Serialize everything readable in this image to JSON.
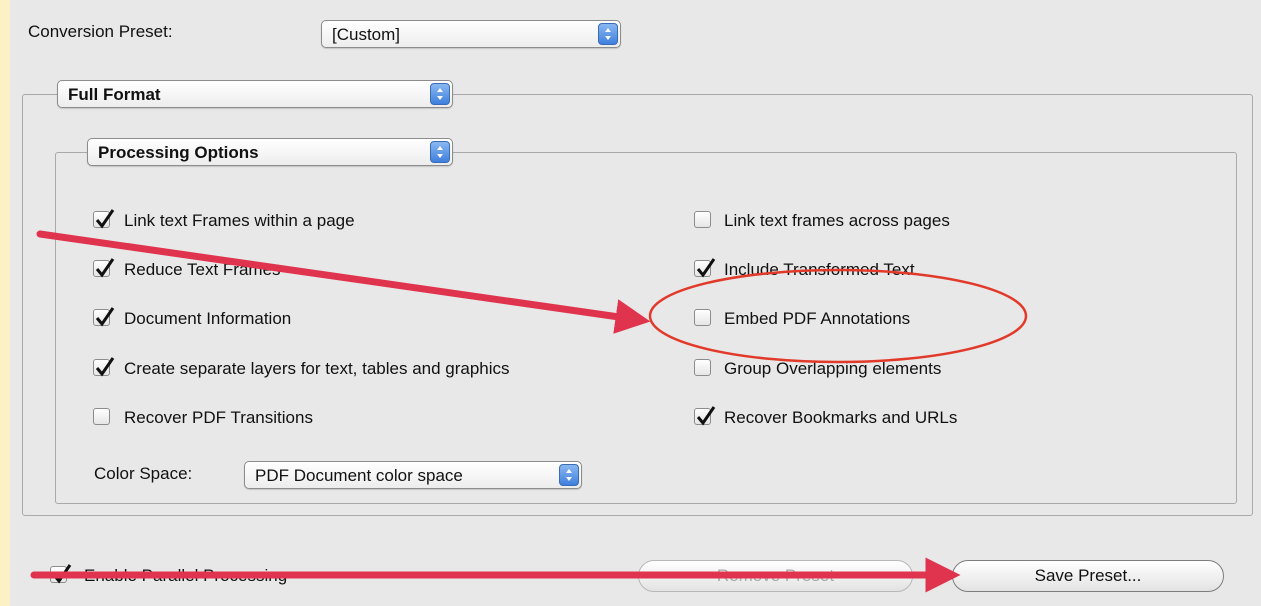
{
  "conversion_preset": {
    "label": "Conversion Preset:",
    "value": "[Custom]"
  },
  "format_popup": {
    "value": "Full Format"
  },
  "options_popup": {
    "value": "Processing Options"
  },
  "options": {
    "left": [
      {
        "label": "Link text Frames within a page",
        "checked": true
      },
      {
        "label": "Reduce Text Frames",
        "checked": true
      },
      {
        "label": "Document Information",
        "checked": true
      },
      {
        "label": "Create separate layers for text, tables and graphics",
        "checked": true
      },
      {
        "label": "Recover PDF Transitions",
        "checked": false
      }
    ],
    "right": [
      {
        "label": "Link text frames across pages",
        "checked": false
      },
      {
        "label": "Include Transformed Text",
        "checked": true
      },
      {
        "label": "Embed PDF Annotations",
        "checked": false
      },
      {
        "label": "Group Overlapping elements",
        "checked": false
      },
      {
        "label": "Recover Bookmarks and URLs",
        "checked": true
      }
    ]
  },
  "color_space": {
    "label": "Color Space:",
    "value": "PDF Document color space"
  },
  "parallel": {
    "label": "Enable Parallel Processing",
    "checked": true
  },
  "buttons": {
    "remove_preset": "Remove Preset",
    "save_preset": "Save Preset..."
  },
  "colors": {
    "annotation_red": "#e0344e",
    "highlight_circle": "#e23a2a",
    "background_yellow": "#fbf1c4",
    "dialog_gray": "#e8e8e8"
  }
}
